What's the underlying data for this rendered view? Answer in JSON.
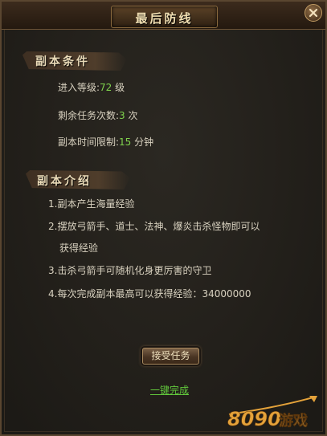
{
  "window": {
    "title": "最后防线"
  },
  "conditions": {
    "heading": "副本条件",
    "level_label": "进入等级:",
    "level_value": "72",
    "level_unit": " 级",
    "count_label": "剩余任务次数:",
    "count_value": "3",
    "count_unit": " 次",
    "time_label": "副本时间限制:",
    "time_value": "15",
    "time_unit": " 分钟"
  },
  "intro": {
    "heading": "副本介绍",
    "items": [
      "1.副本产生海量经验",
      "2.摆放弓箭手、道士、法神、爆炎击杀怪物即可以",
      "获得经验",
      "3.击杀弓箭手可随机化身更厉害的守卫",
      "4.每次完成副本最高可以获得经验：34000000"
    ]
  },
  "actions": {
    "accept_label": "接受任务",
    "complete_label": "一键完成"
  },
  "watermark": {
    "text": "8090游戏"
  },
  "colors": {
    "highlight_green": "#7fd34d",
    "link_green": "#62c83c"
  },
  "icons": {
    "close": "close-icon"
  }
}
